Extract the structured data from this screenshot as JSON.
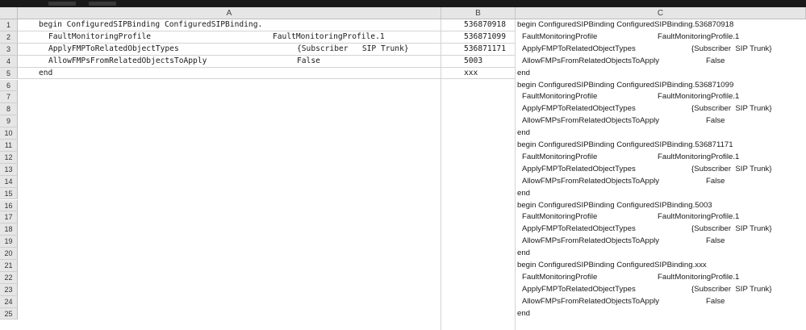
{
  "columns": [
    "A",
    "B",
    "C"
  ],
  "rows": [
    {
      "num": "1",
      "a": [
        "begin ConfiguredSIPBinding ConfiguredSIPBinding.",
        ""
      ],
      "b": "536870918",
      "c": [
        "begin ConfiguredSIPBinding ConfiguredSIPBinding.536870918",
        ""
      ]
    },
    {
      "num": "2",
      "a": [
        "FaultMonitoringProfile",
        "FaultMonitoringProfile.1"
      ],
      "b": "536871099",
      "c": [
        "FaultMonitoringProfile",
        "FaultMonitoringProfile.1"
      ]
    },
    {
      "num": "3",
      "a": [
        "ApplyFMPToRelatedObjectTypes",
        "{Subscriber   SIP Trunk}"
      ],
      "b": "536871171",
      "c": [
        "ApplyFMPToRelatedObjectTypes",
        "{Subscriber  SIP Trunk}"
      ]
    },
    {
      "num": "4",
      "a": [
        "AllowFMPsFromRelatedObjectsToApply",
        "False"
      ],
      "b": "5003",
      "c": [
        "AllowFMPsFromRelatedObjectsToApply",
        "False"
      ]
    },
    {
      "num": "5",
      "a": [
        "end",
        ""
      ],
      "b": "xxx",
      "c": [
        "end",
        ""
      ]
    },
    {
      "num": "6",
      "a": [
        "",
        ""
      ],
      "b": "",
      "c": [
        "begin ConfiguredSIPBinding ConfiguredSIPBinding.536871099",
        ""
      ]
    },
    {
      "num": "7",
      "a": [
        "",
        ""
      ],
      "b": "",
      "c": [
        "FaultMonitoringProfile",
        "FaultMonitoringProfile.1"
      ]
    },
    {
      "num": "8",
      "a": [
        "",
        ""
      ],
      "b": "",
      "c": [
        "ApplyFMPToRelatedObjectTypes",
        "{Subscriber  SIP Trunk}"
      ]
    },
    {
      "num": "9",
      "a": [
        "",
        ""
      ],
      "b": "",
      "c": [
        "AllowFMPsFromRelatedObjectsToApply",
        "False"
      ]
    },
    {
      "num": "10",
      "a": [
        "",
        ""
      ],
      "b": "",
      "c": [
        "end",
        ""
      ]
    },
    {
      "num": "11",
      "a": [
        "",
        ""
      ],
      "b": "",
      "c": [
        "begin ConfiguredSIPBinding ConfiguredSIPBinding.536871171",
        ""
      ]
    },
    {
      "num": "12",
      "a": [
        "",
        ""
      ],
      "b": "",
      "c": [
        "FaultMonitoringProfile",
        "FaultMonitoringProfile.1"
      ]
    },
    {
      "num": "13",
      "a": [
        "",
        ""
      ],
      "b": "",
      "c": [
        "ApplyFMPToRelatedObjectTypes",
        "{Subscriber  SIP Trunk}"
      ]
    },
    {
      "num": "14",
      "a": [
        "",
        ""
      ],
      "b": "",
      "c": [
        "AllowFMPsFromRelatedObjectsToApply",
        "False"
      ]
    },
    {
      "num": "15",
      "a": [
        "",
        ""
      ],
      "b": "",
      "c": [
        "end",
        ""
      ]
    },
    {
      "num": "16",
      "a": [
        "",
        ""
      ],
      "b": "",
      "c": [
        "begin ConfiguredSIPBinding ConfiguredSIPBinding.5003",
        ""
      ]
    },
    {
      "num": "17",
      "a": [
        "",
        ""
      ],
      "b": "",
      "c": [
        "FaultMonitoringProfile",
        "FaultMonitoringProfile.1"
      ]
    },
    {
      "num": "18",
      "a": [
        "",
        ""
      ],
      "b": "",
      "c": [
        "ApplyFMPToRelatedObjectTypes",
        "{Subscriber  SIP Trunk}"
      ]
    },
    {
      "num": "19",
      "a": [
        "",
        ""
      ],
      "b": "",
      "c": [
        "AllowFMPsFromRelatedObjectsToApply",
        "False"
      ]
    },
    {
      "num": "20",
      "a": [
        "",
        ""
      ],
      "b": "",
      "c": [
        "end",
        ""
      ]
    },
    {
      "num": "21",
      "a": [
        "",
        ""
      ],
      "b": "",
      "c": [
        "begin ConfiguredSIPBinding ConfiguredSIPBinding.xxx",
        ""
      ]
    },
    {
      "num": "22",
      "a": [
        "",
        ""
      ],
      "b": "",
      "c": [
        "FaultMonitoringProfile",
        "FaultMonitoringProfile.1"
      ]
    },
    {
      "num": "23",
      "a": [
        "",
        ""
      ],
      "b": "",
      "c": [
        "ApplyFMPToRelatedObjectTypes",
        "{Subscriber  SIP Trunk}"
      ]
    },
    {
      "num": "24",
      "a": [
        "",
        ""
      ],
      "b": "",
      "c": [
        "AllowFMPsFromRelatedObjectsToApply",
        "False"
      ]
    },
    {
      "num": "25",
      "a": [
        "",
        ""
      ],
      "b": "",
      "c": [
        "end",
        ""
      ]
    }
  ]
}
